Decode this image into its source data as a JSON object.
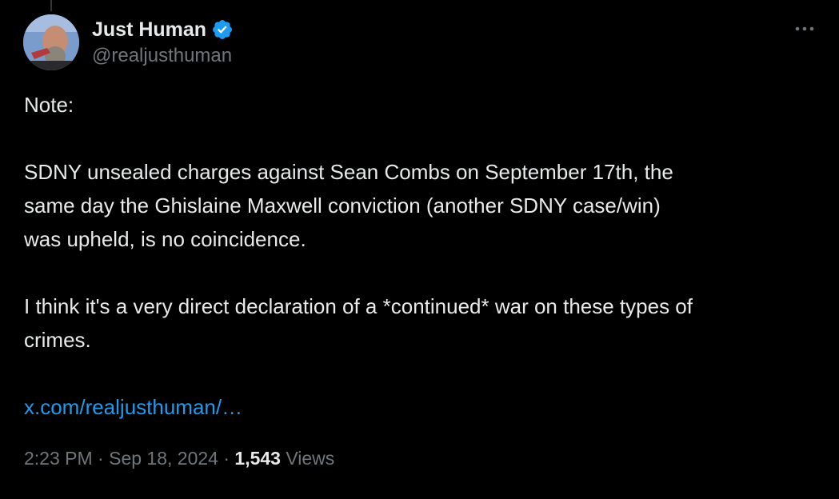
{
  "author": {
    "display_name": "Just Human",
    "handle": "@realjusthuman",
    "verified": true,
    "verified_color": "#1d9bf0",
    "avatar_icon": "profile-photo"
  },
  "tweet": {
    "paragraphs": [
      "Note:",
      "SDNY unsealed charges against Sean Combs on September 17th, the\nsame day the Ghislaine Maxwell conviction (another SDNY case/win)\nwas upheld, is no coincidence.",
      "I think it's a very direct declaration of a *continued* war on these types of\ncrimes."
    ],
    "link_text": "x.com/realjusthuman/…",
    "link_color": "#1d9bf0"
  },
  "meta": {
    "time": "2:23 PM",
    "separator": "·",
    "date": "Sep 18, 2024",
    "views_count": "1,543",
    "views_label": "Views"
  },
  "colors": {
    "background": "#000000",
    "text_primary": "#e7e9ea",
    "text_secondary": "#71767b"
  },
  "icons": {
    "more": "more-options-icon",
    "verified": "verified-badge-icon"
  }
}
